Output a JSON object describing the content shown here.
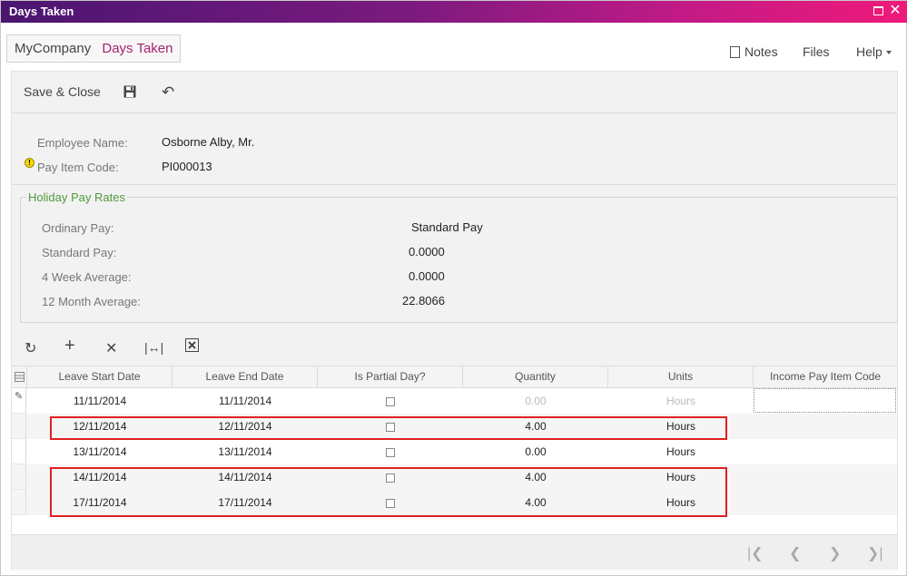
{
  "window": {
    "title": "Days Taken"
  },
  "breadcrumb": {
    "company": "MyCompany",
    "page": "Days Taken"
  },
  "top_links": {
    "notes": "Notes",
    "files": "Files",
    "help": "Help"
  },
  "toolbar": {
    "save_close": "Save & Close"
  },
  "header": {
    "employee_label": "Employee Name:",
    "employee_value": "Osborne Alby, Mr.",
    "pay_item_label": "Pay Item Code:",
    "pay_item_value": "PI000013"
  },
  "holiday_pay_rates": {
    "title": "Holiday Pay Rates",
    "ordinary_label": "Ordinary Pay:",
    "ordinary_value": "Standard Pay",
    "standard_label": "Standard Pay:",
    "standard_value": "0.0000",
    "week4_label": "4 Week Average:",
    "week4_value": "0.0000",
    "month12_label": "12 Month Average:",
    "month12_value": "22.8066"
  },
  "grid": {
    "columns": [
      "Leave Start Date",
      "Leave End Date",
      "Is Partial Day?",
      "Quantity",
      "Units",
      "Income Pay Item Code"
    ],
    "rows": [
      {
        "start": "11/11/2014",
        "end": "11/11/2014",
        "partial": false,
        "quantity": "0.00",
        "units": "Hours",
        "income": ""
      },
      {
        "start": "12/11/2014",
        "end": "12/11/2014",
        "partial": false,
        "quantity": "4.00",
        "units": "Hours",
        "income": ""
      },
      {
        "start": "13/11/2014",
        "end": "13/11/2014",
        "partial": false,
        "quantity": "0.00",
        "units": "Hours",
        "income": ""
      },
      {
        "start": "14/11/2014",
        "end": "14/11/2014",
        "partial": false,
        "quantity": "4.00",
        "units": "Hours",
        "income": ""
      },
      {
        "start": "17/11/2014",
        "end": "17/11/2014",
        "partial": false,
        "quantity": "4.00",
        "units": "Hours",
        "income": ""
      }
    ]
  },
  "colors": {
    "accent": "#a3226e",
    "group_title": "#4f9a3c",
    "highlight": "#e02020"
  }
}
